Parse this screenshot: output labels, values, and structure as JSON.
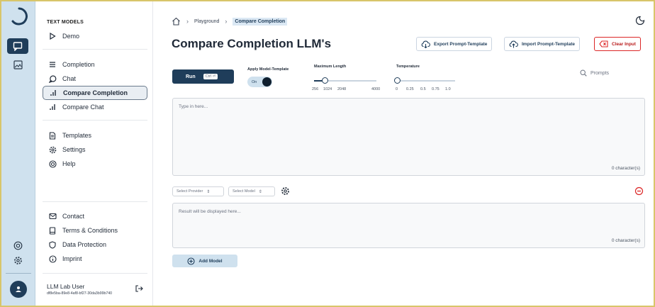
{
  "sidebar": {
    "heading": "TEXT MODELS",
    "demo": "Demo",
    "items": [
      {
        "label": "Completion",
        "icon": "lines-icon"
      },
      {
        "label": "Chat",
        "icon": "chat-bubble-icon"
      },
      {
        "label": "Compare Completion",
        "icon": "bar-chart-icon"
      },
      {
        "label": "Compare Chat",
        "icon": "bar-chart-icon"
      }
    ],
    "tools": [
      {
        "label": "Templates",
        "icon": "document-icon"
      },
      {
        "label": "Settings",
        "icon": "gear-icon"
      },
      {
        "label": "Help",
        "icon": "lifebuoy-icon"
      }
    ],
    "footer_links": [
      {
        "label": "Contact",
        "icon": "mail-icon"
      },
      {
        "label": "Terms & Conditions",
        "icon": "clipboard-icon"
      },
      {
        "label": "Data Protection",
        "icon": "shield-icon"
      },
      {
        "label": "Imprint",
        "icon": "info-icon"
      }
    ],
    "user": {
      "name": "LLM Lab User",
      "id": "df8e5ba-89e8-4af8-bf27-30da3b99b740"
    }
  },
  "breadcrumb": {
    "items": [
      "Playground",
      "Compare Completion"
    ]
  },
  "header": {
    "title": "Compare Completion LLM's"
  },
  "toolbar": {
    "export_label": "Export Prompt-Template",
    "import_label": "Import Prompt-Template",
    "clear_label": "Clear Input"
  },
  "controls": {
    "run_label": "Run",
    "run_shortcut": "Ctrl ⏎",
    "apply_template_label": "Apply Model-Template",
    "toggle_state": "On",
    "max_length_label": "Maximum Length",
    "max_length_ticks": [
      "256",
      "1024",
      "2048",
      "4000"
    ],
    "max_length_value": 1024,
    "temperature_label": "Temperature",
    "temperature_ticks": [
      "0",
      "0.25",
      "0.5",
      "0.75",
      "1.0"
    ],
    "temperature_value": 0,
    "prompts_label": "Prompts"
  },
  "input": {
    "placeholder": "Type in here...",
    "count": "0 character(s)"
  },
  "model_row": {
    "provider_placeholder": "Select Provider",
    "model_placeholder": "Select Model"
  },
  "result": {
    "placeholder": "Result will be displayed here...",
    "count": "0 character(s)"
  },
  "add_model_label": "Add Model",
  "colors": {
    "primary": "#1f3d5a",
    "accent_light": "#cfe1ee",
    "danger": "#dc2626"
  }
}
